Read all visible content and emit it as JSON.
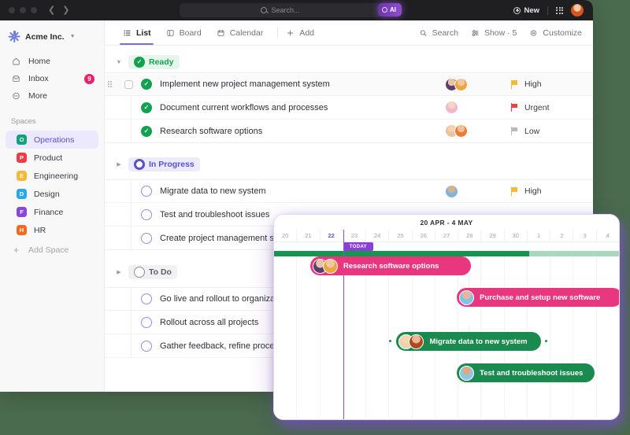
{
  "titlebar": {
    "search_placeholder": "Search...",
    "ai_label": "AI",
    "new_label": "New",
    "search_icon": "search-icon",
    "grid_icon": "apps-grid-icon",
    "avatar": "user-avatar"
  },
  "sidebar": {
    "workspace": "Acme Inc.",
    "nav": [
      {
        "label": "Home",
        "icon": "home-icon",
        "badge": ""
      },
      {
        "label": "Inbox",
        "icon": "inbox-icon",
        "badge": "9"
      },
      {
        "label": "More",
        "icon": "more-icon",
        "badge": ""
      }
    ],
    "spaces_heading": "Spaces",
    "spaces": [
      {
        "label": "Operations",
        "initial": "O",
        "color": "#12a37c",
        "active": true
      },
      {
        "label": "Product",
        "initial": "P",
        "color": "#ee3b48",
        "active": false
      },
      {
        "label": "Engineering",
        "initial": "E",
        "color": "#f5b937",
        "active": false
      },
      {
        "label": "Design",
        "initial": "D",
        "color": "#2ba7ec",
        "active": false
      },
      {
        "label": "Finance",
        "initial": "F",
        "color": "#8b45dd",
        "active": false
      },
      {
        "label": "HR",
        "initial": "H",
        "color": "#f06a22",
        "active": false
      }
    ],
    "add_space": "Add Space"
  },
  "toolbar": {
    "tabs": [
      {
        "label": "List",
        "icon": "list-icon",
        "active": true
      },
      {
        "label": "Board",
        "icon": "board-icon",
        "active": false
      },
      {
        "label": "Calendar",
        "icon": "calendar-icon",
        "active": false
      }
    ],
    "add_label": "Add",
    "right": [
      {
        "label": "Search",
        "icon": "search-icon"
      },
      {
        "label": "Show · 5",
        "icon": "filter-icon"
      },
      {
        "label": "Customize",
        "icon": "gear-icon"
      }
    ]
  },
  "groups": [
    {
      "name": "Ready",
      "status": "done",
      "expanded": true,
      "tasks": [
        {
          "name": "Implement new project management system",
          "status": "done",
          "priority": "High",
          "priority_color": "#f5b937",
          "avatars": [
            "#e8c3a8",
            "#f2a53d"
          ],
          "selected": true
        },
        {
          "name": "Document current workflows and processes",
          "status": "done",
          "priority": "Urgent",
          "priority_color": "#e8434a",
          "avatars": [
            "#f3c2d6"
          ],
          "selected": false
        },
        {
          "name": "Research software options",
          "status": "done",
          "priority": "Low",
          "priority_color": "#b9b9c2",
          "avatars": [
            "#f0cba6",
            "#ef7b3a"
          ],
          "selected": false
        }
      ]
    },
    {
      "name": "In Progress",
      "status": "progress",
      "expanded": false,
      "tasks": [
        {
          "name": "Migrate data to new system",
          "status": "open",
          "priority": "High",
          "priority_color": "#f5b937",
          "avatars": [
            "#7fb6d8"
          ],
          "selected": false
        },
        {
          "name": "Test and troubleshoot issues",
          "status": "open",
          "priority": "",
          "priority_color": "",
          "avatars": [],
          "selected": false
        },
        {
          "name": "Create project management standards",
          "status": "open",
          "priority": "",
          "priority_color": "",
          "avatars": [],
          "selected": false
        }
      ]
    },
    {
      "name": "To Do",
      "status": "todo",
      "expanded": false,
      "tasks": [
        {
          "name": "Go live and rollout to organization",
          "status": "open",
          "priority": "",
          "priority_color": "",
          "avatars": [],
          "selected": false
        },
        {
          "name": "Rollout across all projects",
          "status": "open",
          "priority": "",
          "priority_color": "",
          "avatars": [],
          "selected": false
        },
        {
          "name": "Gather feedback, refine process",
          "status": "open",
          "priority": "",
          "priority_color": "",
          "avatars": [],
          "selected": false
        }
      ]
    }
  ],
  "gantt": {
    "range_title": "20 APR - 4 MAY",
    "today_label": "TODAY",
    "days": [
      "20",
      "21",
      "22",
      "23",
      "24",
      "25",
      "26",
      "27",
      "28",
      "29",
      "30",
      "1",
      "2",
      "3",
      "4"
    ],
    "today_index": 2,
    "progress_percent": 74,
    "bars": [
      {
        "label": "Research software options",
        "color": "pink",
        "avatars": [
          "#e8c3a8",
          "#f2a53d"
        ],
        "left_pct": 10.5,
        "width_pct": 46.5,
        "row": 0
      },
      {
        "label": "Purchase and setup new software",
        "color": "pink",
        "avatars": [
          "#7fb6d8"
        ],
        "left_pct": 53.0,
        "width_pct": 48.0,
        "row": 1
      },
      {
        "label": "Migrate data to new system",
        "color": "green",
        "avatars": [
          "#f0cba6",
          "#ef7b3a"
        ],
        "left_pct": 35.5,
        "width_pct": 42.0,
        "row": 2
      },
      {
        "label": "Test and troubleshoot issues",
        "color": "green",
        "avatars": [
          "#7fb6d8"
        ],
        "left_pct": 53.0,
        "width_pct": 40.0,
        "row": 3
      }
    ]
  }
}
